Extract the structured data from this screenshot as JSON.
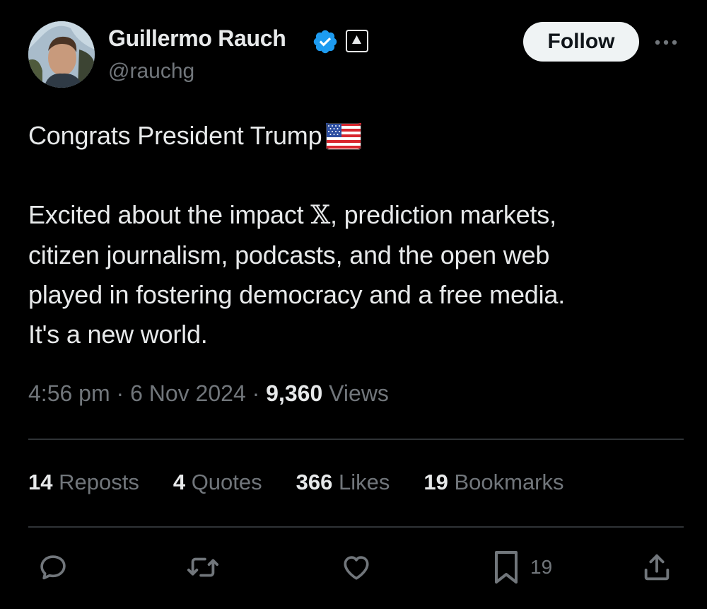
{
  "author": {
    "display_name": "Guillermo Rauch",
    "handle": "@rauchg",
    "verified": true
  },
  "header": {
    "follow_label": "Follow",
    "more_icon": "more-horizontal-icon"
  },
  "tweet": {
    "line1": "Congrats President Trump",
    "emoji_flag": "us-flag-icon",
    "line2_part1": "Excited about the impact ",
    "x_glyph": "𝕏",
    "line2_part2": ", prediction markets,",
    "line3": "citizen journalism, podcasts, and the open web",
    "line4": "played in fostering democracy and a free media.",
    "line5": "It's a new world."
  },
  "meta": {
    "time": "4:56 pm",
    "sep1": " · ",
    "date": "6 Nov 2024",
    "sep2": " · ",
    "views_count": "9,360",
    "views_label": " Views"
  },
  "stats": {
    "reposts_count": "14",
    "reposts_label": " Reposts",
    "quotes_count": "4",
    "quotes_label": " Quotes",
    "likes_count": "366",
    "likes_label": " Likes",
    "bookmarks_count": "19",
    "bookmarks_label": " Bookmarks"
  },
  "actions": {
    "reply_icon": "reply-icon",
    "repost_icon": "repost-icon",
    "like_icon": "heart-icon",
    "bookmark_icon": "bookmark-icon",
    "bookmark_count": "19",
    "share_icon": "share-icon"
  },
  "colors": {
    "background": "#000000",
    "text": "#e7e9ea",
    "secondary": "#71767b",
    "verified": "#1d9bf0",
    "divider": "#2f3336",
    "follow_bg": "#eff3f4"
  }
}
